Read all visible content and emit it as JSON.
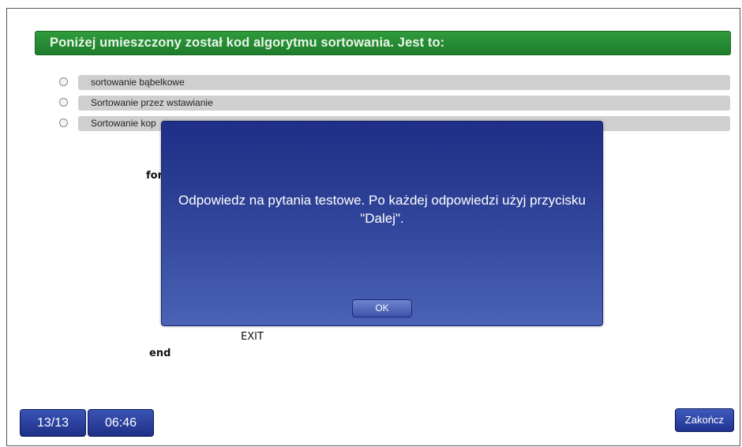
{
  "question": {
    "text": "Poniżej umieszczony został kod algorytmu sortowania. Jest to:"
  },
  "options": [
    {
      "label": "sortowanie bąbelkowe"
    },
    {
      "label": "Sortowanie przez wstawianie"
    },
    {
      "label": "Sortowanie kop"
    }
  ],
  "code": {
    "for_keyword": "for",
    "exit_keyword": "EXIT",
    "end_keyword": "end"
  },
  "modal": {
    "message": "Odpowiedz na pytania testowe. Po każdej odpowiedzi użyj przycisku \"Dalej\".",
    "ok_label": "OK"
  },
  "footer": {
    "question_counter": "13/13",
    "timer": "06:46",
    "finish_label": "Zakończ"
  },
  "colors": {
    "question_bar": "#268a33",
    "modal_top": "#1f2e86",
    "modal_bottom": "#4a63b6",
    "button_blue": "#2a3f9e"
  }
}
